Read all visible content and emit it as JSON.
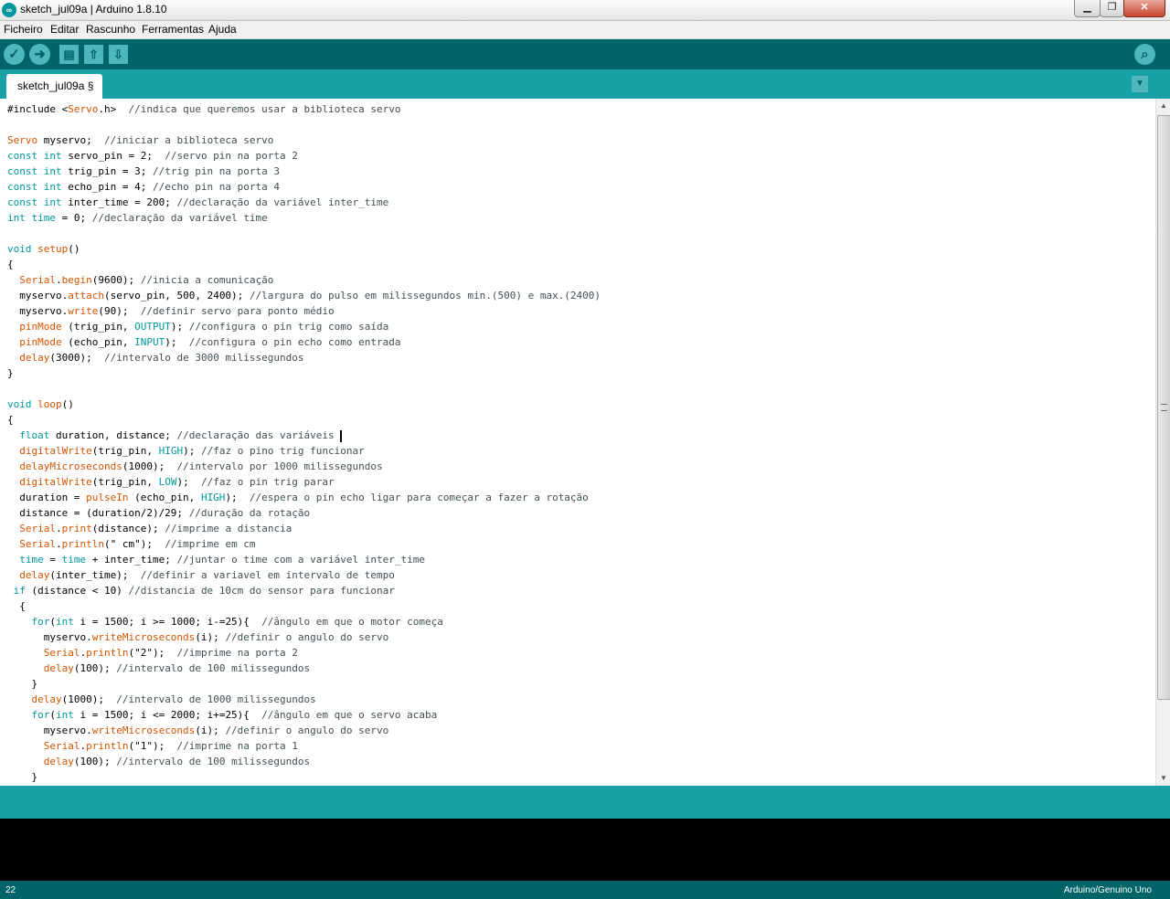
{
  "window": {
    "title": "sketch_jul09a | Arduino 1.8.10",
    "controls": {
      "minimize": "▁",
      "maximize": "❐",
      "close": "✕"
    }
  },
  "menu": [
    "Ficheiro",
    "Editar",
    "Rascunho",
    "Ferramentas",
    "Ajuda"
  ],
  "toolbar": {
    "verify_icon": "✓",
    "upload_icon": "➜",
    "new_icon": "▤",
    "open_icon": "⇧",
    "save_icon": "⇩",
    "serial_monitor_icon": "⌕"
  },
  "tabs": [
    {
      "label": "sketch_jul09a §"
    }
  ],
  "tab_menu_icon": "▼",
  "status": {
    "line": "22",
    "board": "Arduino/Genuino Uno"
  },
  "colors": {
    "keyword": "#00979c",
    "function": "#d35400",
    "comment": "#434f54",
    "toolbar": "#006468",
    "tabstrip": "#17a1a5"
  },
  "code_lines": [
    [
      [
        "t",
        "#include <"
      ],
      [
        "f",
        "Servo"
      ],
      [
        "t",
        ".h>  "
      ],
      [
        "c",
        "//indica que queremos usar a biblioteca servo"
      ]
    ],
    [],
    [
      [
        "f",
        "Servo"
      ],
      [
        "t",
        " myservo;  "
      ],
      [
        "c",
        "//iniciar a biblioteca servo"
      ]
    ],
    [
      [
        "k",
        "const int"
      ],
      [
        "t",
        " servo_pin = 2;  "
      ],
      [
        "c",
        "//servo pin na porta 2"
      ]
    ],
    [
      [
        "k",
        "const int"
      ],
      [
        "t",
        " trig_pin = 3; "
      ],
      [
        "c",
        "//trig pin na porta 3"
      ]
    ],
    [
      [
        "k",
        "const int"
      ],
      [
        "t",
        " echo_pin = 4; "
      ],
      [
        "c",
        "//echo pin na porta 4"
      ]
    ],
    [
      [
        "k",
        "const int"
      ],
      [
        "t",
        " inter_time = 200; "
      ],
      [
        "c",
        "//declaração da variável inter_time"
      ]
    ],
    [
      [
        "k",
        "int"
      ],
      [
        "t",
        " "
      ],
      [
        "k",
        "time"
      ],
      [
        "t",
        " = 0; "
      ],
      [
        "c",
        "//declaração da variável time"
      ]
    ],
    [],
    [
      [
        "k",
        "void"
      ],
      [
        "t",
        " "
      ],
      [
        "f",
        "setup"
      ],
      [
        "t",
        "()"
      ]
    ],
    [
      [
        "t",
        "{"
      ]
    ],
    [
      [
        "t",
        "  "
      ],
      [
        "f",
        "Serial"
      ],
      [
        "t",
        "."
      ],
      [
        "f",
        "begin"
      ],
      [
        "t",
        "(9600); "
      ],
      [
        "c",
        "//inicia a comunicação"
      ]
    ],
    [
      [
        "t",
        "  myservo."
      ],
      [
        "f",
        "attach"
      ],
      [
        "t",
        "(servo_pin, 500, 2400); "
      ],
      [
        "c",
        "//largura do pulso em milissegundos min.(500) e max.(2400)"
      ]
    ],
    [
      [
        "t",
        "  myservo."
      ],
      [
        "f",
        "write"
      ],
      [
        "t",
        "(90);  "
      ],
      [
        "c",
        "//definir servo para ponto médio"
      ]
    ],
    [
      [
        "t",
        "  "
      ],
      [
        "f",
        "pinMode"
      ],
      [
        "t",
        " (trig_pin, "
      ],
      [
        "k",
        "OUTPUT"
      ],
      [
        "t",
        "); "
      ],
      [
        "c",
        "//configura o pin trig como saída"
      ]
    ],
    [
      [
        "t",
        "  "
      ],
      [
        "f",
        "pinMode"
      ],
      [
        "t",
        " (echo_pin, "
      ],
      [
        "k",
        "INPUT"
      ],
      [
        "t",
        ");  "
      ],
      [
        "c",
        "//configura o pin echo como entrada"
      ]
    ],
    [
      [
        "t",
        "  "
      ],
      [
        "f",
        "delay"
      ],
      [
        "t",
        "(3000);  "
      ],
      [
        "c",
        "//intervalo de 3000 milissegundos"
      ]
    ],
    [
      [
        "t",
        "}"
      ]
    ],
    [],
    [
      [
        "k",
        "void"
      ],
      [
        "t",
        " "
      ],
      [
        "f",
        "loop"
      ],
      [
        "t",
        "()"
      ]
    ],
    [
      [
        "t",
        "{"
      ]
    ],
    [
      [
        "t",
        "  "
      ],
      [
        "k",
        "float"
      ],
      [
        "t",
        " duration, distance; "
      ],
      [
        "c",
        "//declaração das variáveis"
      ],
      [
        "cur",
        ""
      ]
    ],
    [
      [
        "t",
        "  "
      ],
      [
        "f",
        "digitalWrite"
      ],
      [
        "t",
        "(trig_pin, "
      ],
      [
        "k",
        "HIGH"
      ],
      [
        "t",
        "); "
      ],
      [
        "c",
        "//faz o pino trig funcionar"
      ]
    ],
    [
      [
        "t",
        "  "
      ],
      [
        "f",
        "delayMicroseconds"
      ],
      [
        "t",
        "(1000);  "
      ],
      [
        "c",
        "//intervalo por 1000 milissegundos"
      ]
    ],
    [
      [
        "t",
        "  "
      ],
      [
        "f",
        "digitalWrite"
      ],
      [
        "t",
        "(trig_pin, "
      ],
      [
        "k",
        "LOW"
      ],
      [
        "t",
        ");  "
      ],
      [
        "c",
        "//faz o pin trig parar"
      ]
    ],
    [
      [
        "t",
        "  duration = "
      ],
      [
        "f",
        "pulseIn"
      ],
      [
        "t",
        " (echo_pin, "
      ],
      [
        "k",
        "HIGH"
      ],
      [
        "t",
        ");  "
      ],
      [
        "c",
        "//espera o pin echo ligar para começar a fazer a rotação"
      ]
    ],
    [
      [
        "t",
        "  distance = (duration/2)/29; "
      ],
      [
        "c",
        "//duração da rotação"
      ]
    ],
    [
      [
        "t",
        "  "
      ],
      [
        "f",
        "Serial"
      ],
      [
        "t",
        "."
      ],
      [
        "f",
        "print"
      ],
      [
        "t",
        "(distance); "
      ],
      [
        "c",
        "//imprime a distancia"
      ]
    ],
    [
      [
        "t",
        "  "
      ],
      [
        "f",
        "Serial"
      ],
      [
        "t",
        "."
      ],
      [
        "f",
        "println"
      ],
      [
        "t",
        "(\" cm\");  "
      ],
      [
        "c",
        "//imprime em cm"
      ]
    ],
    [
      [
        "t",
        "  "
      ],
      [
        "k",
        "time"
      ],
      [
        "t",
        " = "
      ],
      [
        "k",
        "time"
      ],
      [
        "t",
        " + inter_time; "
      ],
      [
        "c",
        "//juntar o time com a variável inter_time"
      ]
    ],
    [
      [
        "t",
        "  "
      ],
      [
        "f",
        "delay"
      ],
      [
        "t",
        "(inter_time);  "
      ],
      [
        "c",
        "//definir a variavel em intervalo de tempo"
      ]
    ],
    [
      [
        "t",
        " "
      ],
      [
        "k",
        "if"
      ],
      [
        "t",
        " (distance < 10) "
      ],
      [
        "c",
        "//distancia de 10cm do sensor para funcionar"
      ]
    ],
    [
      [
        "t",
        "  {"
      ]
    ],
    [
      [
        "t",
        "    "
      ],
      [
        "k",
        "for"
      ],
      [
        "t",
        "("
      ],
      [
        "k",
        "int"
      ],
      [
        "t",
        " i = 1500; i >= 1000; i-=25){  "
      ],
      [
        "c",
        "//ângulo em que o motor começa"
      ]
    ],
    [
      [
        "t",
        "      myservo."
      ],
      [
        "f",
        "writeMicroseconds"
      ],
      [
        "t",
        "(i); "
      ],
      [
        "c",
        "//definir o angulo do servo"
      ]
    ],
    [
      [
        "t",
        "      "
      ],
      [
        "f",
        "Serial"
      ],
      [
        "t",
        "."
      ],
      [
        "f",
        "println"
      ],
      [
        "t",
        "(\"2\");  "
      ],
      [
        "c",
        "//imprime na porta 2"
      ]
    ],
    [
      [
        "t",
        "      "
      ],
      [
        "f",
        "delay"
      ],
      [
        "t",
        "(100); "
      ],
      [
        "c",
        "//intervalo de 100 milissegundos"
      ]
    ],
    [
      [
        "t",
        "    }"
      ]
    ],
    [
      [
        "t",
        "    "
      ],
      [
        "f",
        "delay"
      ],
      [
        "t",
        "(1000);  "
      ],
      [
        "c",
        "//intervalo de 1000 milissegundos"
      ]
    ],
    [
      [
        "t",
        "    "
      ],
      [
        "k",
        "for"
      ],
      [
        "t",
        "("
      ],
      [
        "k",
        "int"
      ],
      [
        "t",
        " i = 1500; i <= 2000; i+=25){  "
      ],
      [
        "c",
        "//ângulo em que o servo acaba"
      ]
    ],
    [
      [
        "t",
        "      myservo."
      ],
      [
        "f",
        "writeMicroseconds"
      ],
      [
        "t",
        "(i); "
      ],
      [
        "c",
        "//definir o angulo do servo"
      ]
    ],
    [
      [
        "t",
        "      "
      ],
      [
        "f",
        "Serial"
      ],
      [
        "t",
        "."
      ],
      [
        "f",
        "println"
      ],
      [
        "t",
        "(\"1\");  "
      ],
      [
        "c",
        "//imprime na porta 1"
      ]
    ],
    [
      [
        "t",
        "      "
      ],
      [
        "f",
        "delay"
      ],
      [
        "t",
        "(100); "
      ],
      [
        "c",
        "//intervalo de 100 milissegundos"
      ]
    ],
    [
      [
        "t",
        "    }"
      ]
    ]
  ]
}
